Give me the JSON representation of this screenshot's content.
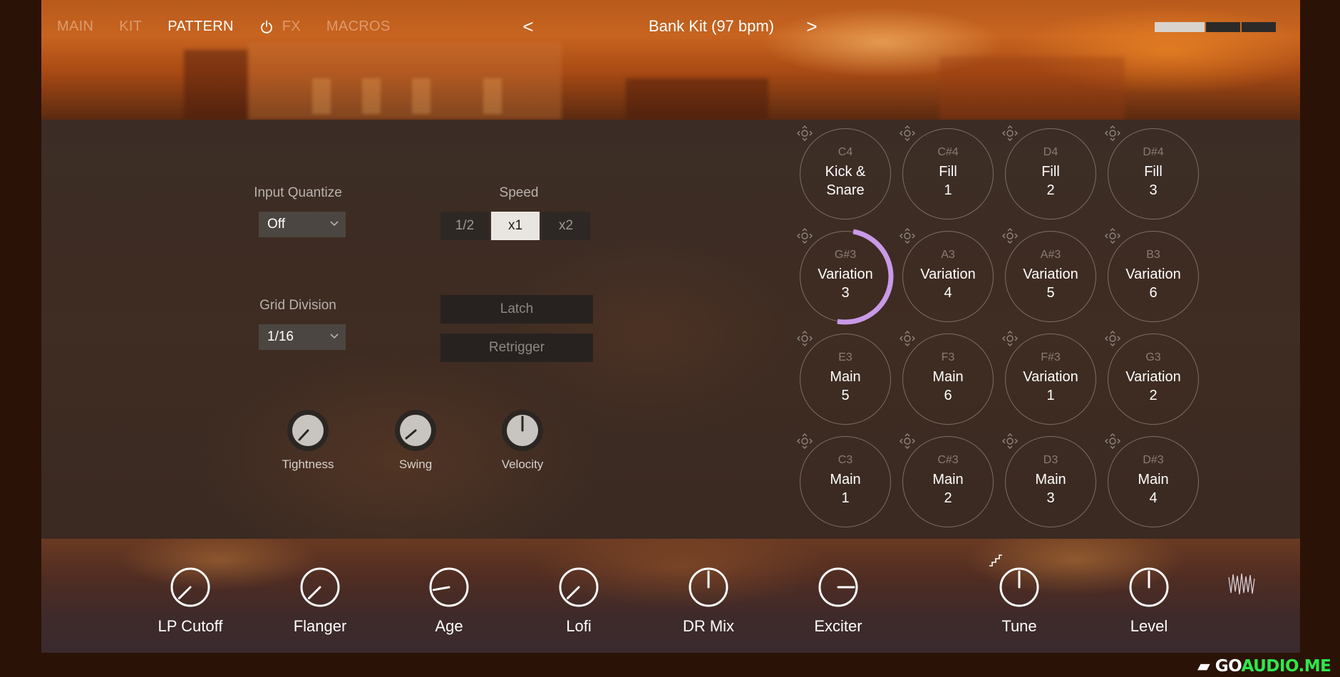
{
  "header": {
    "tabs": [
      {
        "label": "MAIN",
        "active": false
      },
      {
        "label": "KIT",
        "active": false
      },
      {
        "label": "PATTERN",
        "active": true
      }
    ],
    "fx_label": "FX",
    "macros_label": "MACROS",
    "kit_title": "Bank Kit (97 bpm)",
    "prev_arrow": "<",
    "next_arrow": ">"
  },
  "pattern": {
    "input_quantize_label": "Input Quantize",
    "input_quantize_value": "Off",
    "speed_label": "Speed",
    "speed_options": [
      "1/2",
      "x1",
      "x2"
    ],
    "speed_selected": "x1",
    "grid_division_label": "Grid Division",
    "grid_division_value": "1/16",
    "latch_label": "Latch",
    "retrigger_label": "Retrigger",
    "knobs": [
      {
        "label": "Tightness"
      },
      {
        "label": "Swing"
      },
      {
        "label": "Velocity"
      }
    ]
  },
  "pads": [
    {
      "note": "C4",
      "line1": "Kick &",
      "line2": "Snare"
    },
    {
      "note": "C#4",
      "line1": "Fill",
      "line2": "1"
    },
    {
      "note": "D4",
      "line1": "Fill",
      "line2": "2"
    },
    {
      "note": "D#4",
      "line1": "Fill",
      "line2": "3"
    },
    {
      "note": "G#3",
      "line1": "Variation",
      "line2": "3",
      "active": true
    },
    {
      "note": "A3",
      "line1": "Variation",
      "line2": "4"
    },
    {
      "note": "A#3",
      "line1": "Variation",
      "line2": "5"
    },
    {
      "note": "B3",
      "line1": "Variation",
      "line2": "6"
    },
    {
      "note": "E3",
      "line1": "Main",
      "line2": "5"
    },
    {
      "note": "F3",
      "line1": "Main",
      "line2": "6"
    },
    {
      "note": "F#3",
      "line1": "Variation",
      "line2": "1"
    },
    {
      "note": "G3",
      "line1": "Variation",
      "line2": "2"
    },
    {
      "note": "C3",
      "line1": "Main",
      "line2": "1"
    },
    {
      "note": "C#3",
      "line1": "Main",
      "line2": "2"
    },
    {
      "note": "D3",
      "line1": "Main",
      "line2": "3"
    },
    {
      "note": "D#3",
      "line1": "Main",
      "line2": "4"
    }
  ],
  "bottom": {
    "knobs": [
      {
        "label": "LP Cutoff"
      },
      {
        "label": "Flanger"
      },
      {
        "label": "Age"
      },
      {
        "label": "Lofi"
      },
      {
        "label": "DR Mix"
      },
      {
        "label": "Exciter"
      },
      {
        "label": "Tune"
      },
      {
        "label": "Level"
      }
    ]
  },
  "watermark": {
    "part1": "GO",
    "part2": "AUDIO.ME"
  },
  "colors": {
    "accent_arc": "#c89ae8",
    "selected_button": "#e9e6e2",
    "panel_bg": "#3d2c23",
    "watermark_green": "#2ee84a"
  }
}
